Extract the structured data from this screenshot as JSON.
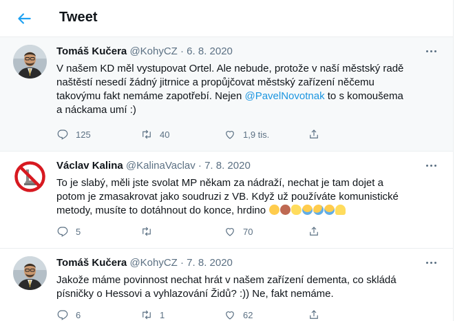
{
  "header": {
    "title": "Tweet"
  },
  "tweets": [
    {
      "name": "Tomáš Kučera",
      "meta": "@KohyCZ · 6. 8. 2020",
      "lines": [
        "V našem KD měl vystupovat Ortel. Ale nebude, protože v naší městský radě",
        "naštěstí nesedí žádný jitrnice a propůjčovat městský zařízení něčemu",
        "takovýmu fakt nemáme zapotřebí. Nejen "
      ],
      "mention": "@PavelNovotnak",
      "after_mention": " to s komoušema",
      "last_line": "a náckama umí :)",
      "replies": "125",
      "retweets": "40",
      "likes": "1,9 tis."
    },
    {
      "name": "Václav Kalina",
      "meta": "@KalinaVaclav · 7. 8. 2020",
      "lines": [
        "To je slabý, měli jste svolat MP někam za nádraží, nechat je tam dojet a",
        "potom je zmasakrovat jako soudruzi z VB. Když už používáte komunistické",
        "metody, musíte to dotáhnout do konce, hrdino "
      ],
      "emojis": [
        "slightly-frowning-face",
        "see-no-evil-monkey",
        "flexed-biceps",
        "face-with-tears-of-joy",
        "rolling-on-floor-laughing",
        "face-with-tears-of-joy",
        "folded-hands"
      ],
      "replies": "5",
      "retweets": "",
      "likes": "70"
    },
    {
      "name": "Tomáš Kučera",
      "meta": "@KohyCZ · 7. 8. 2020",
      "lines": [
        "Jakože máme povinnost nechat hrát v našem zařízení dementa, co skládá",
        "písničky o Hessovi a vyhlazování Židů? :)) Ne, fakt nemáme."
      ],
      "replies": "6",
      "retweets": "1",
      "likes": "62"
    }
  ],
  "colors": {
    "accent": "#1da1f2",
    "mention": "#1b95e0",
    "muted": "#5b7083",
    "highlight_bg": "#f7f9fa"
  }
}
